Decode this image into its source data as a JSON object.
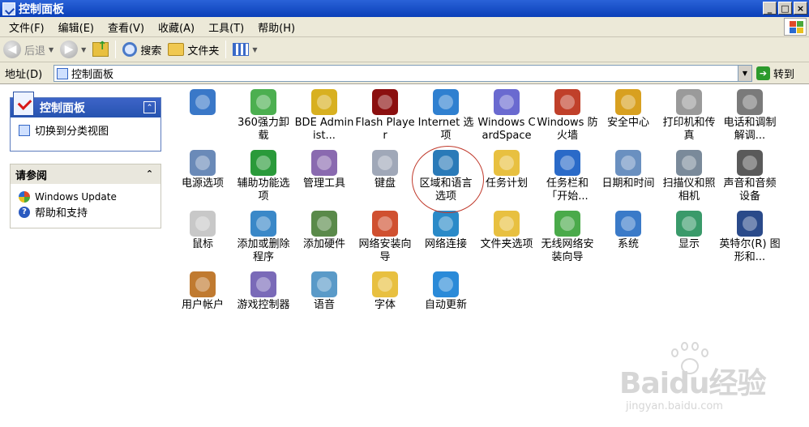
{
  "window": {
    "title": "控制面板",
    "buttons": [
      "_",
      "□",
      "×"
    ]
  },
  "menu": [
    "文件(F)",
    "编辑(E)",
    "查看(V)",
    "收藏(A)",
    "工具(T)",
    "帮助(H)"
  ],
  "toolbar": {
    "back_label": "后退",
    "search_label": "搜索",
    "folders_label": "文件夹"
  },
  "address": {
    "label": "地址(D)",
    "value": "控制面板",
    "go_label": "转到"
  },
  "left_pane": {
    "task_panel": {
      "title": "控制面板",
      "link": "切换到分类视图"
    },
    "see_also": {
      "title": "请参阅",
      "links": [
        "Windows Update",
        "帮助和支持"
      ]
    }
  },
  "items": [
    {
      "label": "",
      "icon": "network-icon",
      "color": "#3a78c8"
    },
    {
      "label": "360强力卸载",
      "icon": "uninstall-icon",
      "color": "#4caf50"
    },
    {
      "label": "BDE Administ...",
      "icon": "bde-icon",
      "color": "#d8b020"
    },
    {
      "label": "Flash Player",
      "icon": "flash-icon",
      "color": "#8b0f0f"
    },
    {
      "label": "Internet 选项",
      "icon": "internet-options-icon",
      "color": "#2f80d0"
    },
    {
      "label": "Windows CardSpace",
      "icon": "cardspace-icon",
      "color": "#6a6ad0"
    },
    {
      "label": "Windows 防火墙",
      "icon": "firewall-icon",
      "color": "#c0402a"
    },
    {
      "label": "安全中心",
      "icon": "security-center-icon",
      "color": "#d8a020"
    },
    {
      "label": "打印机和传真",
      "icon": "printer-icon",
      "color": "#9a9a9a"
    },
    {
      "label": "电话和调制解调...",
      "icon": "phone-modem-icon",
      "color": "#7a7a7a"
    },
    {
      "label": "电源选项",
      "icon": "power-icon",
      "color": "#6a8ab8"
    },
    {
      "label": "辅助功能选项",
      "icon": "accessibility-icon",
      "color": "#2a9a3a"
    },
    {
      "label": "管理工具",
      "icon": "admin-tools-icon",
      "color": "#8a6ab0"
    },
    {
      "label": "键盘",
      "icon": "keyboard-icon",
      "color": "#a0a8b8"
    },
    {
      "label": "区域和语言选项",
      "icon": "globe-icon",
      "color": "#2a7ab8"
    },
    {
      "label": "任务计划",
      "icon": "scheduled-tasks-icon",
      "color": "#e8c040"
    },
    {
      "label": "任务栏和「开始...",
      "icon": "taskbar-icon",
      "color": "#2a6ac8"
    },
    {
      "label": "日期和时间",
      "icon": "datetime-icon",
      "color": "#6a90c0"
    },
    {
      "label": "扫描仪和照相机",
      "icon": "scanner-icon",
      "color": "#7a8a9a"
    },
    {
      "label": "声音和音频设备",
      "icon": "sound-icon",
      "color": "#5a5a5a"
    },
    {
      "label": "鼠标",
      "icon": "mouse-icon",
      "color": "#c8c8c8"
    },
    {
      "label": "添加或删除程序",
      "icon": "add-remove-icon",
      "color": "#3a88c8"
    },
    {
      "label": "添加硬件",
      "icon": "add-hardware-icon",
      "color": "#5a8a4a"
    },
    {
      "label": "网络安装向导",
      "icon": "network-setup-icon",
      "color": "#d05030"
    },
    {
      "label": "网络连接",
      "icon": "network-connections-icon",
      "color": "#2a8ac8"
    },
    {
      "label": "文件夹选项",
      "icon": "folder-options-icon",
      "color": "#e8c040"
    },
    {
      "label": "无线网络安装向导",
      "icon": "wireless-icon",
      "color": "#4aaa4a"
    },
    {
      "label": "系统",
      "icon": "system-icon",
      "color": "#3a7ac8"
    },
    {
      "label": "显示",
      "icon": "display-icon",
      "color": "#3a9a6a"
    },
    {
      "label": "英特尔(R) 图形和...",
      "icon": "intel-graphics-icon",
      "color": "#2a4a8a"
    },
    {
      "label": "用户帐户",
      "icon": "user-accounts-icon",
      "color": "#c07a30"
    },
    {
      "label": "游戏控制器",
      "icon": "game-controller-icon",
      "color": "#7a6ab8"
    },
    {
      "label": "语音",
      "icon": "speech-icon",
      "color": "#5a9ac8"
    },
    {
      "label": "字体",
      "icon": "fonts-icon",
      "color": "#e8c040"
    },
    {
      "label": "自动更新",
      "icon": "auto-update-icon",
      "color": "#2a8ad8"
    }
  ],
  "watermark": {
    "brand": "Baidu经验",
    "url": "jingyan.baidu.com"
  }
}
